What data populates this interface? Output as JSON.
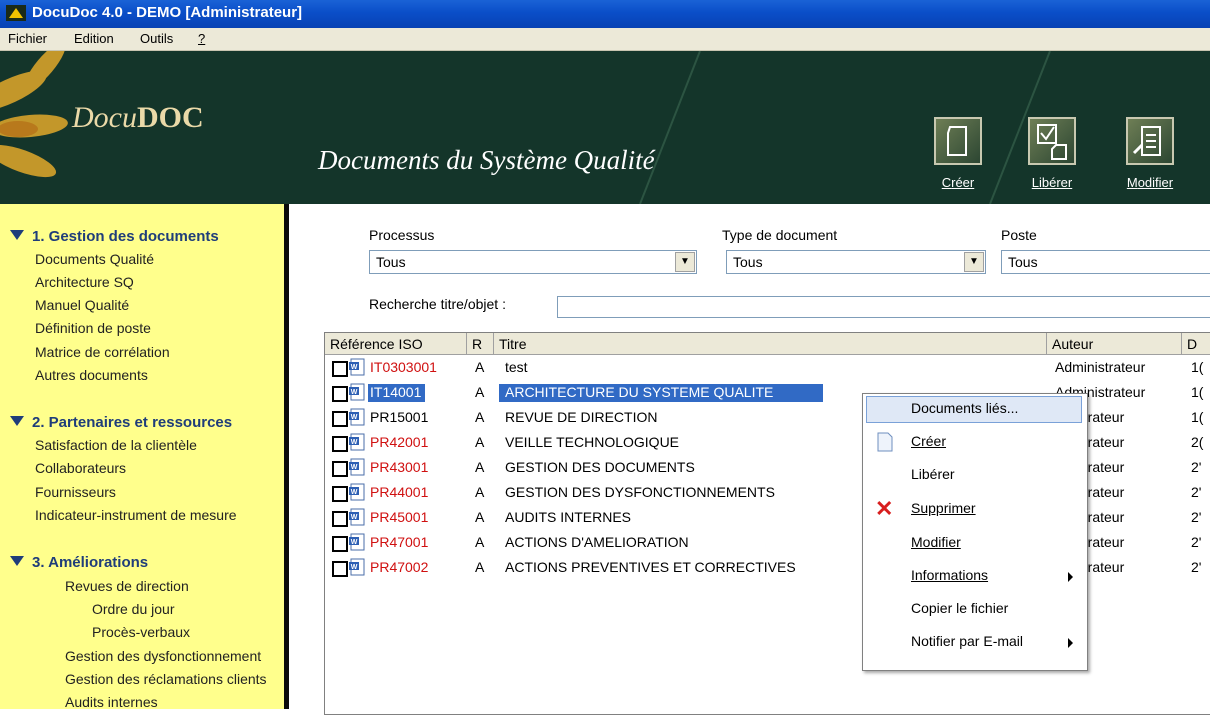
{
  "window": {
    "title": "DocuDoc 4.0 - DEMO [Administrateur]"
  },
  "menu": [
    "Fichier",
    "Edition",
    "Outils",
    "?"
  ],
  "banner": {
    "logo_part1": "Docu",
    "logo_part2": "DOC",
    "heading": "Documents du Système Qualité",
    "buttons": [
      {
        "label_first": "C",
        "label_rest": "réer"
      },
      {
        "label_first": "L",
        "label_rest": "ibérer"
      },
      {
        "label_first": "M",
        "label_rest": "odifier"
      }
    ]
  },
  "sidebar": {
    "sections": [
      {
        "title": "1. Gestion des documents",
        "items": [
          "Documents Qualité",
          "Architecture SQ",
          "Manuel Qualité",
          "Définition de poste",
          "Matrice de corrélation",
          "Autres documents"
        ]
      },
      {
        "title": "2. Partenaires et ressources",
        "items": [
          "Satisfaction de la clientèle",
          "Collaborateurs",
          "Fournisseurs",
          "Indicateur-instrument de mesure"
        ]
      },
      {
        "title": "3. Améliorations",
        "items": [
          "Revues de direction",
          "Ordre du jour",
          "Procès-verbaux",
          "Gestion des dysfonctionnement",
          "Gestion des réclamations clients",
          "Audits internes"
        ]
      }
    ]
  },
  "filters": {
    "processus": {
      "label": "Processus",
      "value": "Tous"
    },
    "type": {
      "label": "Type de document",
      "value": "Tous"
    },
    "poste": {
      "label": "Poste",
      "value": "Tous"
    },
    "search_label": "Recherche titre/objet :"
  },
  "table": {
    "columns": [
      "Référence ISO",
      "R",
      "Titre",
      "Auteur",
      "D"
    ],
    "rows": [
      {
        "ref": "IT0303001",
        "r": "A",
        "title": "test",
        "author": "Administrateur",
        "d": "1(",
        "ref_color": "#d01010"
      },
      {
        "ref": "IT14001",
        "r": "A",
        "title": "ARCHITECTURE DU SYSTEME QUALITE",
        "author": "Administrateur",
        "d": "1(",
        "ref_color": "#ffffff"
      },
      {
        "ref": "PR15001",
        "r": "A",
        "title": "REVUE DE DIRECTION",
        "author": "ninistrateur",
        "d": "1(",
        "ref_color": "#000000"
      },
      {
        "ref": "PR42001",
        "r": "A",
        "title": "VEILLE TECHNOLOGIQUE",
        "author": "ninistrateur",
        "d": "2(",
        "ref_color": "#d01010"
      },
      {
        "ref": "PR43001",
        "r": "A",
        "title": "GESTION DES DOCUMENTS",
        "author": "ninistrateur",
        "d": "2'",
        "ref_color": "#d01010"
      },
      {
        "ref": "PR44001",
        "r": "A",
        "title": "GESTION DES DYSFONCTIONNEMENTS",
        "author": "ninistrateur",
        "d": "2'",
        "ref_color": "#d01010"
      },
      {
        "ref": "PR45001",
        "r": "A",
        "title": "AUDITS INTERNES",
        "author": "ninistrateur",
        "d": "2'",
        "ref_color": "#d01010"
      },
      {
        "ref": "PR47001",
        "r": "A",
        "title": "ACTIONS D'AMELIORATION",
        "author": "ninistrateur",
        "d": "2'",
        "ref_color": "#d01010"
      },
      {
        "ref": "PR47002",
        "r": "A",
        "title": "ACTIONS PREVENTIVES ET CORRECTIVES",
        "author": "ninistrateur",
        "d": "2'",
        "ref_color": "#d01010"
      }
    ]
  },
  "context_menu": {
    "items": [
      {
        "label": "Documents liés...",
        "icon": "",
        "submenu": false
      },
      {
        "label": "Créer",
        "icon": "page-icon",
        "submenu": false
      },
      {
        "label": "Libérer",
        "icon": "",
        "submenu": false
      },
      {
        "label": "Supprimer",
        "icon": "delete-x-icon",
        "submenu": false
      },
      {
        "label": "Modifier",
        "icon": "",
        "submenu": false
      },
      {
        "label": "Informations",
        "icon": "",
        "submenu": true
      },
      {
        "label": "Copier le fichier",
        "icon": "",
        "submenu": false
      },
      {
        "label": "Notifier par E-mail",
        "icon": "",
        "submenu": true
      }
    ]
  },
  "colors": {
    "titlebar": "#0a4ec8",
    "banner": "#14352a",
    "sidebar": "#ffff8c",
    "section_title": "#1f3d7a",
    "selection": "#316ac5",
    "ref_red": "#d01010"
  }
}
